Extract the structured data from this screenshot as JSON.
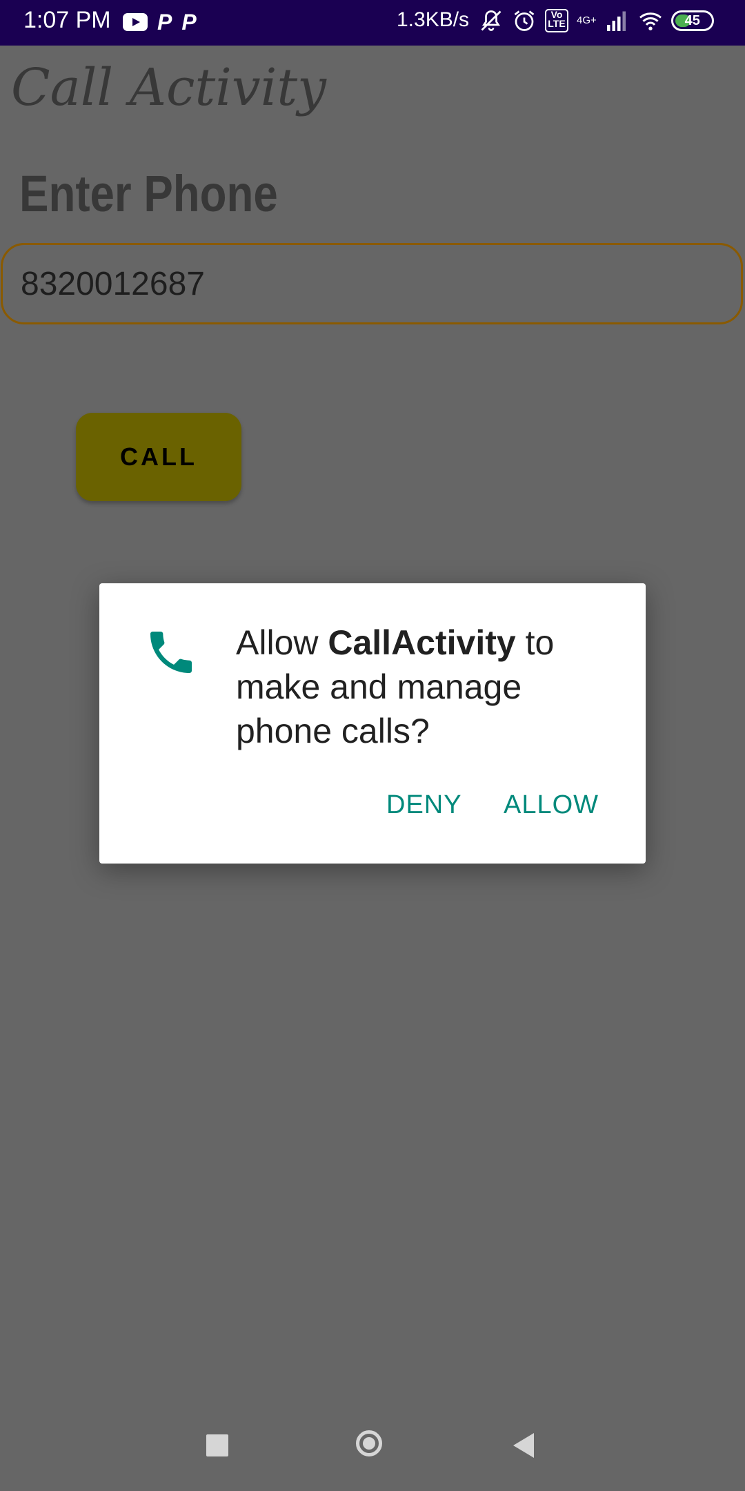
{
  "status_bar": {
    "time": "1:07 PM",
    "left_icons": [
      "youtube-icon",
      "p-icon",
      "p-icon"
    ],
    "p_glyph": "P",
    "network_speed": "1.3KB/s",
    "volte_label": "Vo LTE",
    "network_type": "4G+",
    "battery_level": "45"
  },
  "app": {
    "title": "Call Activity",
    "phone_label": "Enter Phone",
    "phone_value": "8320012687",
    "call_button": "CALL"
  },
  "dialog": {
    "message_prefix": "Allow ",
    "app_name": "CallActivity",
    "message_suffix": " to make and manage phone calls?",
    "icon": "phone-icon",
    "deny_label": "DENY",
    "allow_label": "ALLOW",
    "accent_color": "#00897b"
  },
  "nav": {
    "icons": [
      "recents-icon",
      "home-icon",
      "back-icon"
    ]
  }
}
